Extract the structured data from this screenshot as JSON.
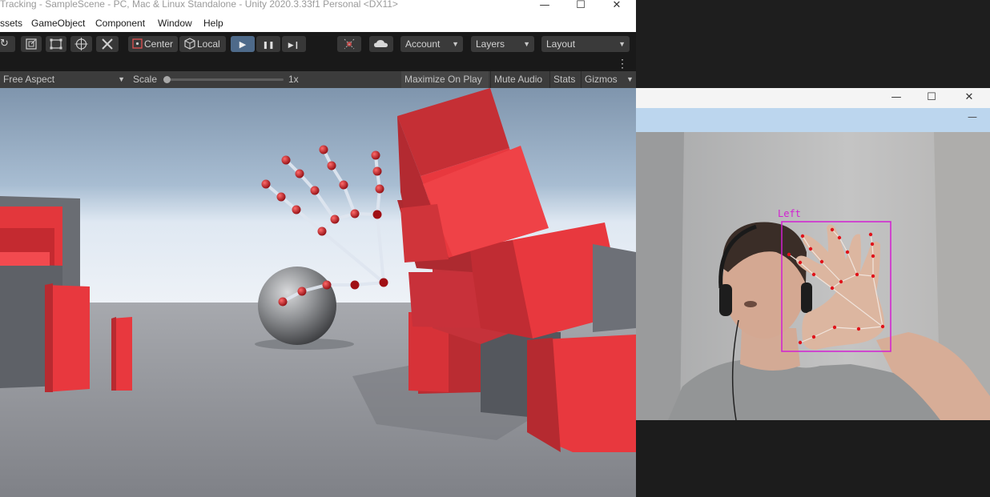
{
  "unity": {
    "title": "Tracking - SampleScene - PC, Mac & Linux Standalone - Unity 2020.3.33f1 Personal <DX11>",
    "window_controls": {
      "minimize": "—",
      "maximize": "☐",
      "close": "✕"
    },
    "menu": [
      "ssets",
      "GameObject",
      "Component",
      "Window",
      "Help"
    ],
    "toolbar": {
      "pivot_mode": "Center",
      "pivot_rotation": "Local",
      "play_icon": "▶",
      "pause_icon": "❚❚",
      "step_icon": "▶❙",
      "account": "Account",
      "layers": "Layers",
      "layout": "Layout"
    },
    "game_view": {
      "aspect": "Free Aspect",
      "scale_label": "Scale",
      "scale_value": "1x",
      "maximize_on_play": "Maximize On Play",
      "mute_audio": "Mute Audio",
      "stats": "Stats",
      "gizmos": "Gizmos"
    }
  },
  "camera_window": {
    "window_controls": {
      "minimize": "—",
      "maximize": "☐",
      "close": "✕"
    },
    "menu_collapse": "—",
    "hand_label": "Left"
  },
  "colors": {
    "sky_top": "#7f95ad",
    "ground": "#8e9198",
    "cube_red": "#e8383e",
    "joint_red": "#b0141a",
    "bone_light": "#dfe6f0",
    "detection_box": "#d21fd2",
    "camera_menu": "#bcd6ee"
  }
}
